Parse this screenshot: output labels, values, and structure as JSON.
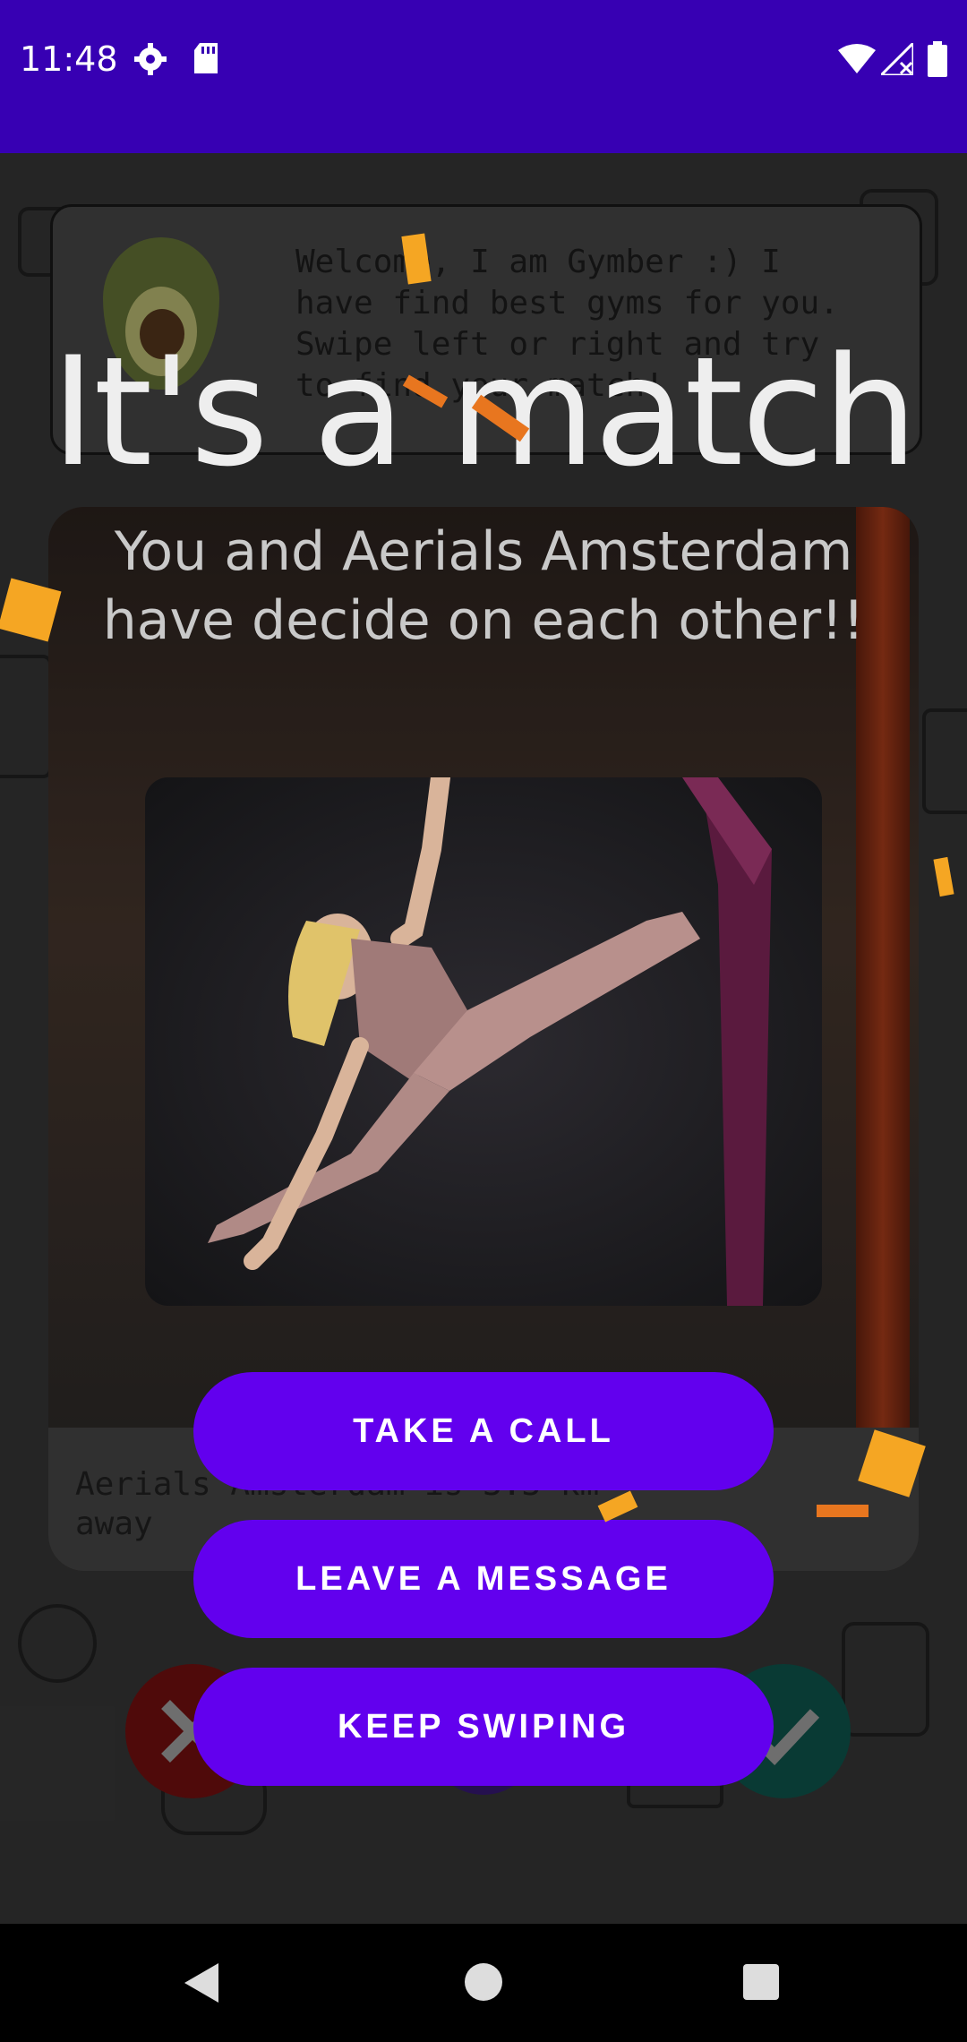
{
  "status_bar": {
    "time": "11:48",
    "icons": [
      "gear-icon",
      "sd-card-icon",
      "wifi-icon",
      "signal-icon",
      "battery-icon"
    ]
  },
  "background": {
    "chat_text": "Welcome, I am Gymber :) I\nhave find best gyms for you.\nSwipe left or right and try\nto find your match!",
    "gym_card_text": "Aerials Amsterdam is 3.3 km\naway"
  },
  "match": {
    "title": "It's a match",
    "subtitle": "You and Aerials Amsterdam have decide on each other!!"
  },
  "buttons": {
    "call": "TAKE A CALL",
    "message": "LEAVE A MESSAGE",
    "swipe": "KEEP SWIPING"
  },
  "colors": {
    "status_bar": "#3700b3",
    "button": "#6200ee",
    "confetti": "#f5a623"
  }
}
